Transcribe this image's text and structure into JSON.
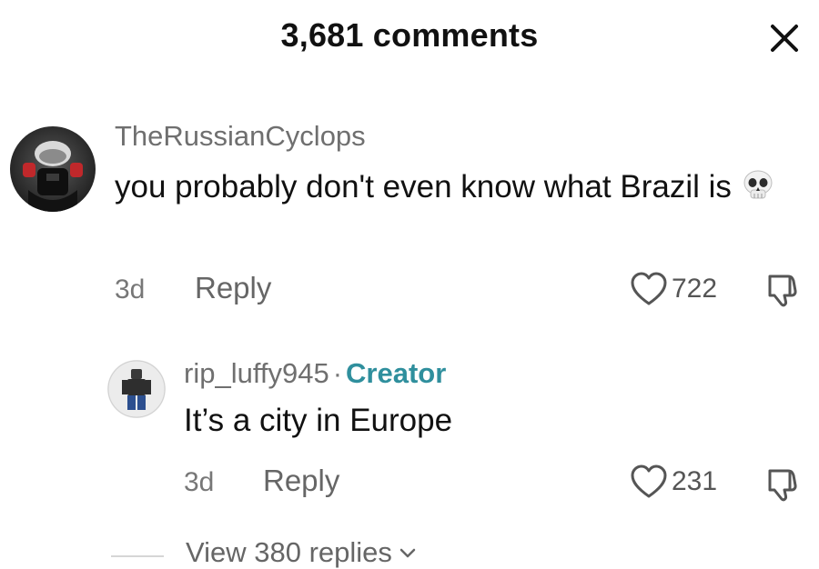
{
  "header": {
    "title": "3,681 comments",
    "close_icon": "close-icon"
  },
  "comments": [
    {
      "username": "TheRussianCyclops",
      "text": "you probably don't even know what Brazil is",
      "emoji": "skull",
      "time": "3d",
      "reply_label": "Reply",
      "likes": "722",
      "avatar": "avatar-dark-helmet"
    }
  ],
  "reply": {
    "username": "rip_luffy945",
    "separator": "·",
    "badge": "Creator",
    "text": "It’s a city in Europe",
    "time": "3d",
    "reply_label": "Reply",
    "likes": "231",
    "avatar": "avatar-roblox-figure"
  },
  "view_replies": {
    "label": "View 380 replies",
    "icon": "chevron-down-icon"
  },
  "colors": {
    "creator": "#2f8f9d",
    "muted": "#6f6f6f",
    "text": "#111111"
  }
}
